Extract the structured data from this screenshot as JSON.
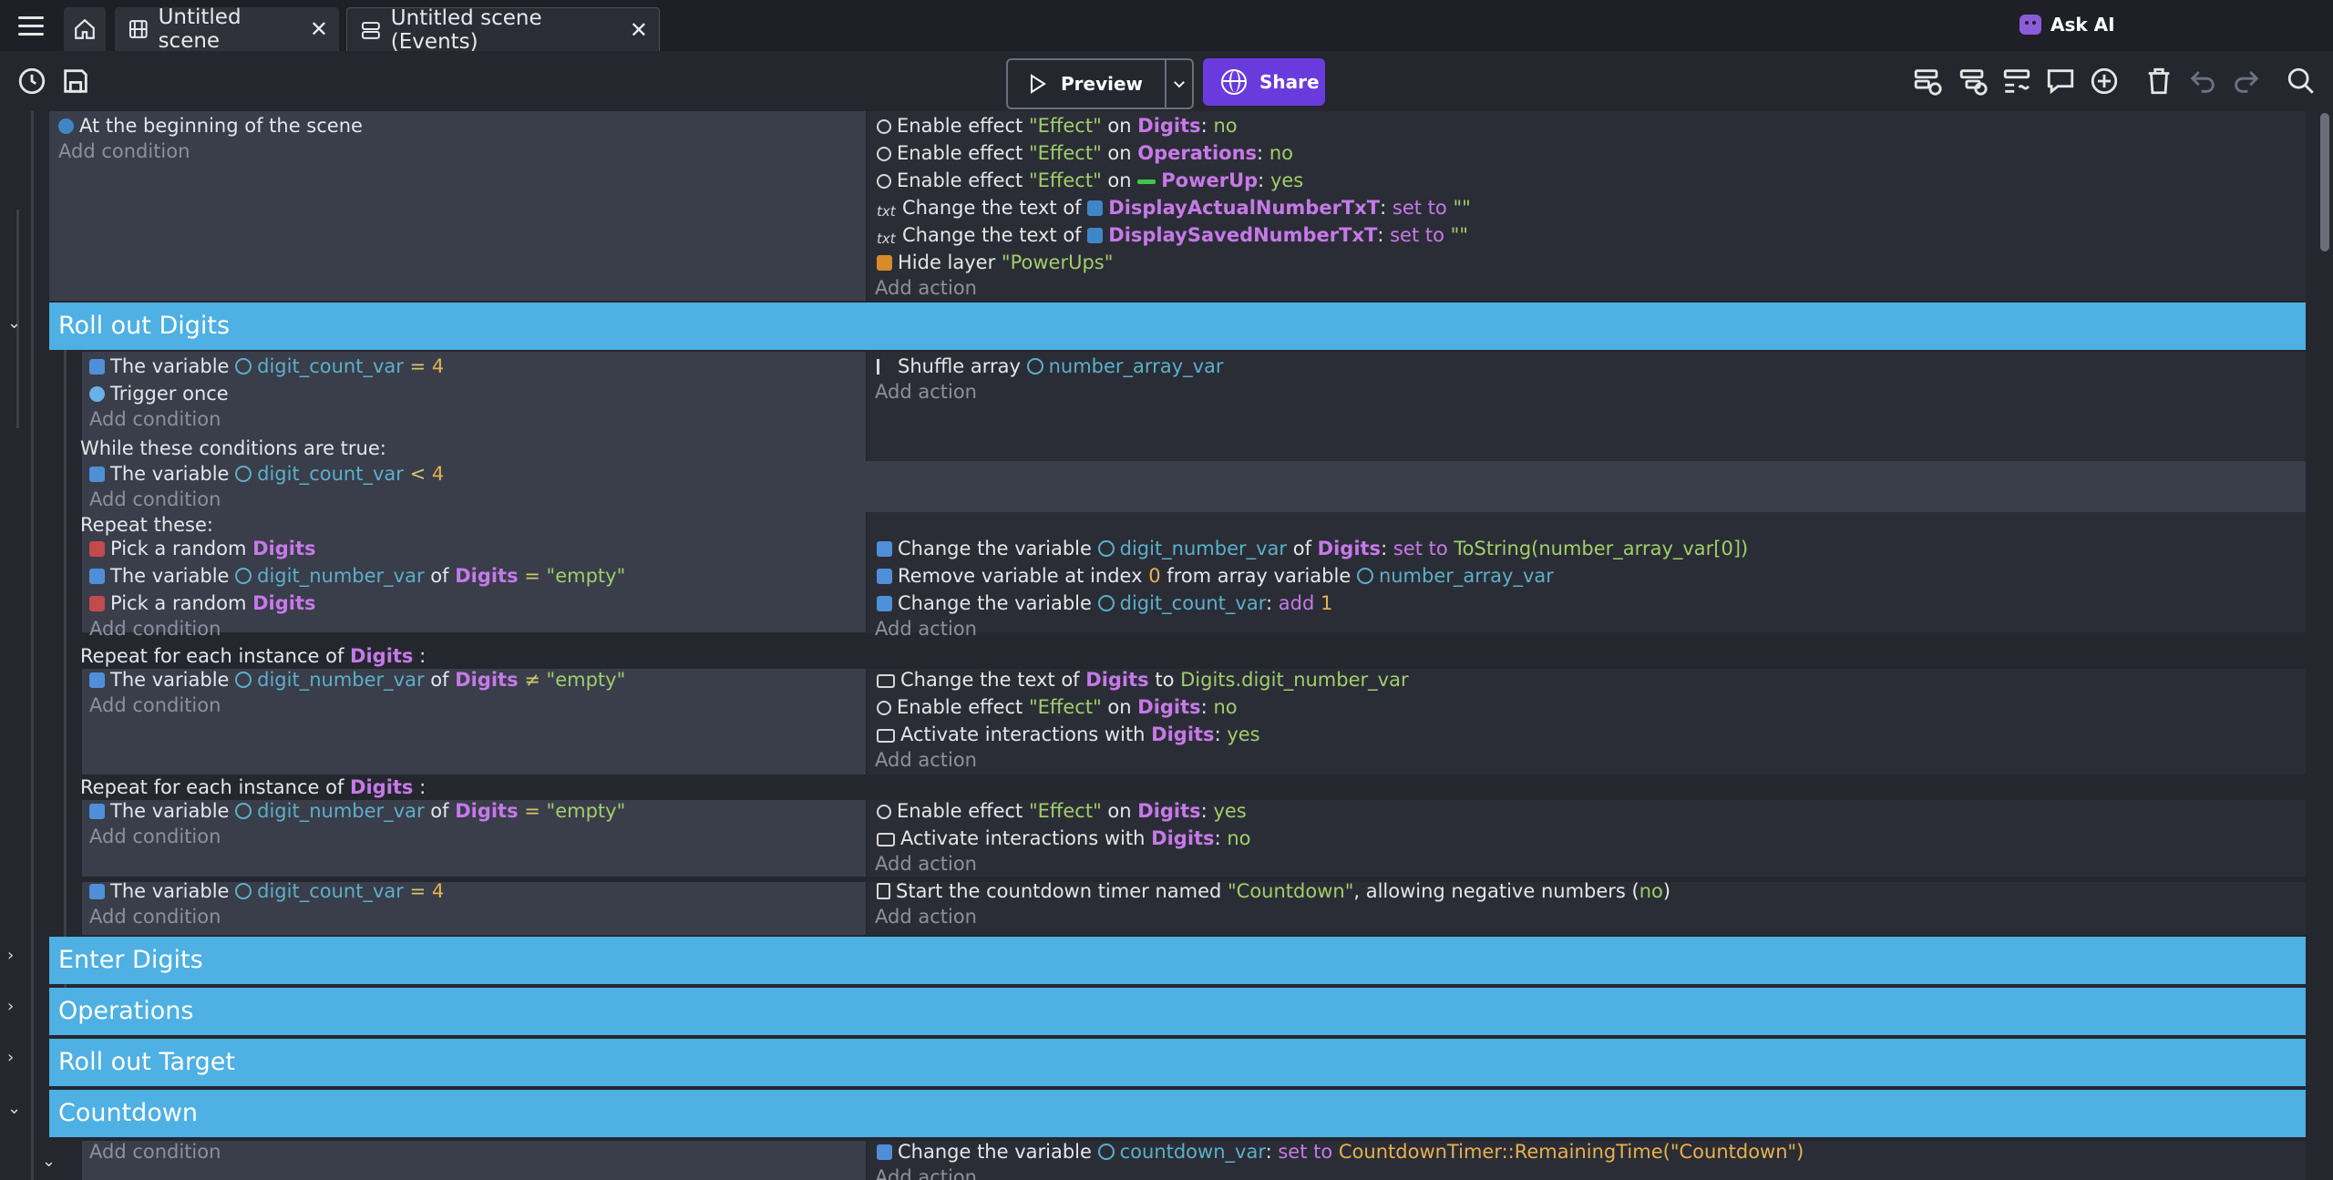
{
  "tabs": [
    {
      "label": "Untitled scene"
    },
    {
      "label": "Untitled scene (Events)"
    }
  ],
  "ask_ai": "Ask AI",
  "toolbar": {
    "preview": "Preview",
    "share": "Share"
  },
  "common": {
    "add_condition": "Add condition",
    "add_action": "Add action"
  },
  "event1": {
    "condition": "At the beginning of the scene",
    "a1": {
      "pre": "Enable effect ",
      "s": "\"Effect\"",
      "mid": " on ",
      "o": "Digits",
      "post": ": ",
      "val": "no"
    },
    "a2": {
      "pre": "Enable effect ",
      "s": "\"Effect\"",
      "mid": " on ",
      "o": "Operations",
      "post": ": ",
      "val": "no"
    },
    "a3": {
      "pre": "Enable effect ",
      "s": "\"Effect\"",
      "mid": " on ",
      "o": "PowerUp",
      "post": ": ",
      "val": "yes"
    },
    "a4": {
      "pre": "Change the text of ",
      "o": "DisplayActualNumberTxT",
      "post": ": ",
      "k": "set to",
      "s": "\"\""
    },
    "a5": {
      "pre": "Change the text of ",
      "o": "DisplaySavedNumberTxT",
      "post": ": ",
      "k": "set to",
      "s": "\"\""
    },
    "a6": {
      "pre": "Hide layer ",
      "s": "\"PowerUps\""
    }
  },
  "groups": {
    "roll_out_digits": "Roll out Digits",
    "enter_digits": "Enter Digits",
    "operations": "Operations",
    "roll_out_target": "Roll out Target",
    "countdown": "Countdown"
  },
  "rod1": {
    "c1": {
      "pre": "The variable ",
      "v": "digit_count_var",
      "op": " = ",
      "n": "4"
    },
    "c2": "Trigger once",
    "a1": {
      "pre": "Shuffle array ",
      "v": "number_array_var"
    }
  },
  "while": {
    "header": "While these conditions are true:",
    "c1": {
      "pre": "The variable ",
      "v": "digit_count_var",
      "op": " < ",
      "n": "4"
    },
    "repeat_header": "Repeat these:"
  },
  "rep": {
    "c1": {
      "pre": "Pick a random ",
      "o": "Digits"
    },
    "c2": {
      "pre": "The variable ",
      "v": "digit_number_var",
      "mid": " of ",
      "o": "Digits",
      "op": " = ",
      "s": "\"empty\""
    },
    "c3": {
      "pre": "Pick a random ",
      "o": "Digits"
    },
    "a1": {
      "pre": "Change the variable ",
      "v": "digit_number_var",
      "mid": " of ",
      "o": "Digits",
      "post": ": ",
      "k": "set to",
      "expr": "ToString(number_array_var[0])"
    },
    "a2": {
      "pre": "Remove variable at index ",
      "n": "0",
      "mid": " from array variable ",
      "v": "number_array_var"
    },
    "a3": {
      "pre": "Change the variable ",
      "v": "digit_count_var",
      "post": ": ",
      "k": "add",
      "n": "1"
    }
  },
  "foreach1": {
    "header_pre": "Repeat for each instance of ",
    "header_o": "Digits",
    "header_post": " :",
    "c1": {
      "pre": "The variable ",
      "v": "digit_number_var",
      "mid": " of ",
      "o": "Digits",
      "op": " ≠ ",
      "s": "\"empty\""
    },
    "a1": {
      "pre": "Change the text of ",
      "o": "Digits",
      "mid": " to ",
      "expr": "Digits.digit_number_var"
    },
    "a2": {
      "pre": "Enable effect ",
      "s": "\"Effect\"",
      "mid": " on ",
      "o": "Digits",
      "post": ": ",
      "val": "no"
    },
    "a3": {
      "pre": "Activate interactions with ",
      "o": "Digits",
      "post": ": ",
      "val": "yes"
    }
  },
  "foreach2": {
    "header_pre": "Repeat for each instance of ",
    "header_o": "Digits",
    "header_post": " :",
    "c1": {
      "pre": "The variable ",
      "v": "digit_number_var",
      "mid": " of ",
      "o": "Digits",
      "op": " = ",
      "s": "\"empty\""
    },
    "a1": {
      "pre": "Enable effect ",
      "s": "\"Effect\"",
      "mid": " on ",
      "o": "Digits",
      "post": ": ",
      "val": "yes"
    },
    "a2": {
      "pre": "Activate interactions with ",
      "o": "Digits",
      "post": ": ",
      "val": "no"
    }
  },
  "last": {
    "c1": {
      "pre": "The variable ",
      "v": "digit_count_var",
      "op": " = ",
      "n": "4"
    },
    "a1": {
      "pre": "Start the countdown timer named ",
      "s": "\"Countdown\"",
      "mid": ", allowing negative numbers (",
      "val": "no",
      "post": ")"
    }
  },
  "countdown_event": {
    "a1": {
      "pre": "Change the variable ",
      "v": "countdown_var",
      "post": ": ",
      "k": "set to",
      "expr": "CountdownTimer::RemainingTime(\"Countdown\")"
    }
  },
  "colors": {
    "group_header": "#4eb0e3",
    "share": "#6a3bdc",
    "background": "#25272f"
  }
}
